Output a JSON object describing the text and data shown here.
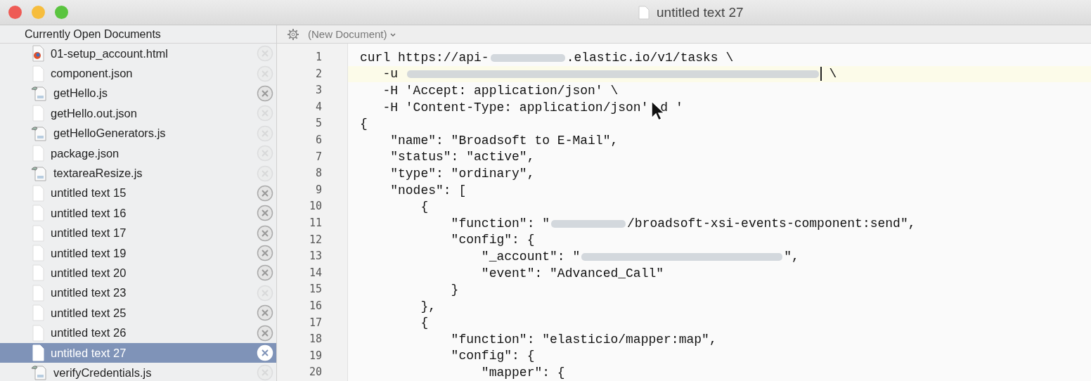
{
  "window": {
    "title": "untitled text 27"
  },
  "sidebar": {
    "title": "Currently Open Documents",
    "items": [
      {
        "label": "01-setup_account.html",
        "kind": "html",
        "selected": false,
        "close_dimmed": true
      },
      {
        "label": "component.json",
        "kind": "plain",
        "selected": false,
        "close_dimmed": true
      },
      {
        "label": "getHello.js",
        "kind": "script",
        "selected": false,
        "close_dimmed": false
      },
      {
        "label": "getHello.out.json",
        "kind": "plain",
        "selected": false,
        "close_dimmed": true
      },
      {
        "label": "getHelloGenerators.js",
        "kind": "script",
        "selected": false,
        "close_dimmed": true
      },
      {
        "label": "package.json",
        "kind": "plain",
        "selected": false,
        "close_dimmed": true
      },
      {
        "label": "textareaResize.js",
        "kind": "script",
        "selected": false,
        "close_dimmed": true
      },
      {
        "label": "untitled text 15",
        "kind": "plain",
        "selected": false,
        "close_dimmed": false
      },
      {
        "label": "untitled text 16",
        "kind": "plain",
        "selected": false,
        "close_dimmed": false
      },
      {
        "label": "untitled text 17",
        "kind": "plain",
        "selected": false,
        "close_dimmed": false
      },
      {
        "label": "untitled text 19",
        "kind": "plain",
        "selected": false,
        "close_dimmed": false
      },
      {
        "label": "untitled text 20",
        "kind": "plain",
        "selected": false,
        "close_dimmed": false
      },
      {
        "label": "untitled text 23",
        "kind": "plain",
        "selected": false,
        "close_dimmed": true
      },
      {
        "label": "untitled text 25",
        "kind": "plain",
        "selected": false,
        "close_dimmed": false
      },
      {
        "label": "untitled text 26",
        "kind": "plain",
        "selected": false,
        "close_dimmed": false
      },
      {
        "label": "untitled text 27",
        "kind": "plain",
        "selected": true,
        "close_dimmed": false
      },
      {
        "label": "verifyCredentials.js",
        "kind": "script",
        "selected": false,
        "close_dimmed": true
      }
    ]
  },
  "editor": {
    "function_menu": "(New Document)",
    "lines": [
      {
        "number": "1",
        "current": false,
        "parts": [
          {
            "kind": "text",
            "text": "curl https://api-"
          },
          {
            "kind": "redacted"
          },
          {
            "kind": "text",
            "text": ".elastic.io/v1/tasks \\"
          }
        ]
      },
      {
        "number": "2",
        "current": true,
        "parts": [
          {
            "kind": "text",
            "text": "   -u "
          },
          {
            "kind": "redactedlong"
          },
          {
            "kind": "caret"
          },
          {
            "kind": "text",
            "text": " \\"
          }
        ]
      },
      {
        "number": "3",
        "current": false,
        "parts": [
          {
            "kind": "text",
            "text": "   -H 'Accept: application/json' \\"
          }
        ]
      },
      {
        "number": "4",
        "current": false,
        "parts": [
          {
            "kind": "text",
            "text": "   -H 'Content-Type: application/json' "
          },
          {
            "kind": "pointer"
          },
          {
            "kind": "text",
            "text": "d '"
          }
        ]
      },
      {
        "number": "5",
        "current": false,
        "parts": [
          {
            "kind": "text",
            "text": "{"
          }
        ]
      },
      {
        "number": "6",
        "current": false,
        "parts": [
          {
            "kind": "text",
            "text": "    \"name\": \"Broadsoft to E-Mail\","
          }
        ]
      },
      {
        "number": "7",
        "current": false,
        "parts": [
          {
            "kind": "text",
            "text": "    \"status\": \"active\","
          }
        ]
      },
      {
        "number": "8",
        "current": false,
        "parts": [
          {
            "kind": "text",
            "text": "    \"type\": \"ordinary\","
          }
        ]
      },
      {
        "number": "9",
        "current": false,
        "parts": [
          {
            "kind": "text",
            "text": "    \"nodes\": ["
          }
        ]
      },
      {
        "number": "10",
        "current": false,
        "parts": [
          {
            "kind": "text",
            "text": "        {"
          }
        ]
      },
      {
        "number": "11",
        "current": false,
        "parts": [
          {
            "kind": "text",
            "text": "            \"function\": \""
          },
          {
            "kind": "redacted"
          },
          {
            "kind": "text",
            "text": "/broadsoft-xsi-events-component:send\","
          }
        ]
      },
      {
        "number": "12",
        "current": false,
        "parts": [
          {
            "kind": "text",
            "text": "            \"config\": {"
          }
        ]
      },
      {
        "number": "13",
        "current": false,
        "parts": [
          {
            "kind": "text",
            "text": "                \"_account\": \""
          },
          {
            "kind": "redactedmedium"
          },
          {
            "kind": "text",
            "text": "\","
          }
        ]
      },
      {
        "number": "14",
        "current": false,
        "parts": [
          {
            "kind": "text",
            "text": "                \"event\": \"Advanced_Call\""
          }
        ]
      },
      {
        "number": "15",
        "current": false,
        "parts": [
          {
            "kind": "text",
            "text": "            }"
          }
        ]
      },
      {
        "number": "16",
        "current": false,
        "parts": [
          {
            "kind": "text",
            "text": "        },"
          }
        ]
      },
      {
        "number": "17",
        "current": false,
        "parts": [
          {
            "kind": "text",
            "text": "        {"
          }
        ]
      },
      {
        "number": "18",
        "current": false,
        "parts": [
          {
            "kind": "text",
            "text": "            \"function\": \"elasticio/mapper:map\","
          }
        ]
      },
      {
        "number": "19",
        "current": false,
        "parts": [
          {
            "kind": "text",
            "text": "            \"config\": {"
          }
        ]
      },
      {
        "number": "20",
        "current": false,
        "parts": [
          {
            "kind": "text",
            "text": "                \"mapper\": {"
          }
        ]
      }
    ]
  }
}
